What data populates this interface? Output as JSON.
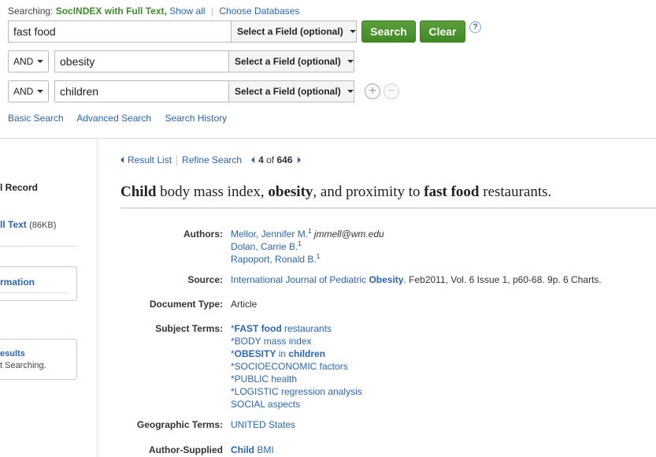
{
  "search": {
    "searching_label": "Searching:",
    "database": "SocINDEX with Full Text,",
    "show_all": "Show all",
    "choose_db": "Choose Databases",
    "rows": [
      {
        "bool": "",
        "term": "fast food",
        "field": "Select a Field (optional)"
      },
      {
        "bool": "AND",
        "term": "obesity",
        "field": "Select a Field (optional)"
      },
      {
        "bool": "AND",
        "term": "children",
        "field": "Select a Field (optional)"
      }
    ],
    "search_button": "Search",
    "clear_button": "Clear",
    "help": "?",
    "add_row": "+",
    "remove_row": "−",
    "links": [
      "Basic Search",
      "Advanced Search",
      "Search History"
    ]
  },
  "left": {
    "record_title": "l Record",
    "pdf_link": "ll Text",
    "pdf_size": "(86KB)",
    "box1_link": "rmation",
    "box2_link": "esults",
    "box2_sub": "t Searching."
  },
  "nav": {
    "result_list": "Result List",
    "refine_search": "Refine Search",
    "position": "4",
    "of": "of",
    "total": "646"
  },
  "article": {
    "title_parts": [
      {
        "text": "Child",
        "bold": true
      },
      {
        "text": " body mass index, ",
        "bold": false
      },
      {
        "text": "obesity",
        "bold": true
      },
      {
        "text": ", and proximity to ",
        "bold": false
      },
      {
        "text": "fast food",
        "bold": true
      },
      {
        "text": " restaurants.",
        "bold": false
      }
    ],
    "labels": {
      "authors": "Authors:",
      "source": "Source:",
      "doc_type": "Document Type:",
      "subject_terms": "Subject Terms:",
      "geographic_terms": "Geographic Terms:",
      "author_supplied": "Author-Supplied"
    },
    "authors": [
      {
        "name": "Mellor, Jennifer M.",
        "sup": "1",
        "email": "jmmell@wm.edu"
      },
      {
        "name": "Dolan, Carrie B.",
        "sup": "1",
        "email": ""
      },
      {
        "name": "Rapoport, Ronald B.",
        "sup": "1",
        "email": ""
      }
    ],
    "source_journal": "International Journal of Pediatric",
    "source_journal_bold": "Obesity",
    "source_details": ". Feb2011, Vol. 6 Issue 1, p60-68. 9p. 6 Charts.",
    "doc_type": "Article",
    "subject_terms": [
      "*FAST food restaurants",
      "*BODY mass index",
      "*OBESITY in children",
      "*SOCIOECONOMIC factors",
      "*PUBLIC health",
      "*LOGISTIC regression analysis",
      "SOCIAL aspects"
    ],
    "geographic_terms": "UNITED States",
    "author_supplied_bold": "Child",
    "author_supplied_rest": " BMI"
  },
  "colors": {
    "link": "#2a66b3",
    "green_button": "#4a9530",
    "database": "#3f8a2e"
  }
}
